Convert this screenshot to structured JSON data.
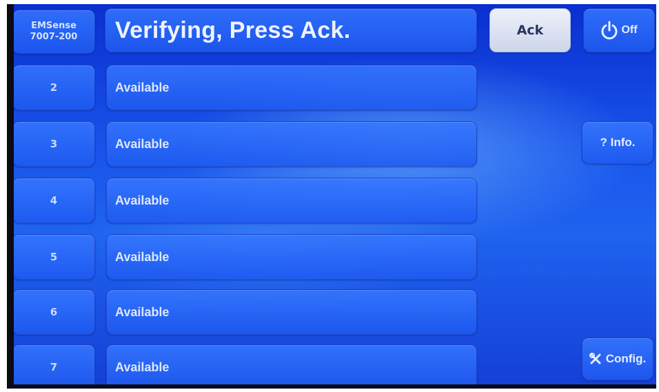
{
  "header": {
    "model_line1": "EMSense",
    "model_line2": "7007-200",
    "status_title": "Verifying, Press Ack.",
    "ack_label": "Ack",
    "off_label": "Off",
    "off_icon": "power-icon"
  },
  "channels": [
    {
      "number": "2",
      "status": "Available"
    },
    {
      "number": "3",
      "status": "Available"
    },
    {
      "number": "4",
      "status": "Available"
    },
    {
      "number": "5",
      "status": "Available"
    },
    {
      "number": "6",
      "status": "Available"
    },
    {
      "number": "7",
      "status": "Available"
    }
  ],
  "side_buttons": {
    "info_label": "? Info.",
    "config_label": "Config.",
    "config_icon": "tools-icon"
  },
  "colors": {
    "background": "#1a56ec",
    "button": "#2f6ff5",
    "ack_button": "#e3e8f5",
    "text": "#e6efff"
  }
}
